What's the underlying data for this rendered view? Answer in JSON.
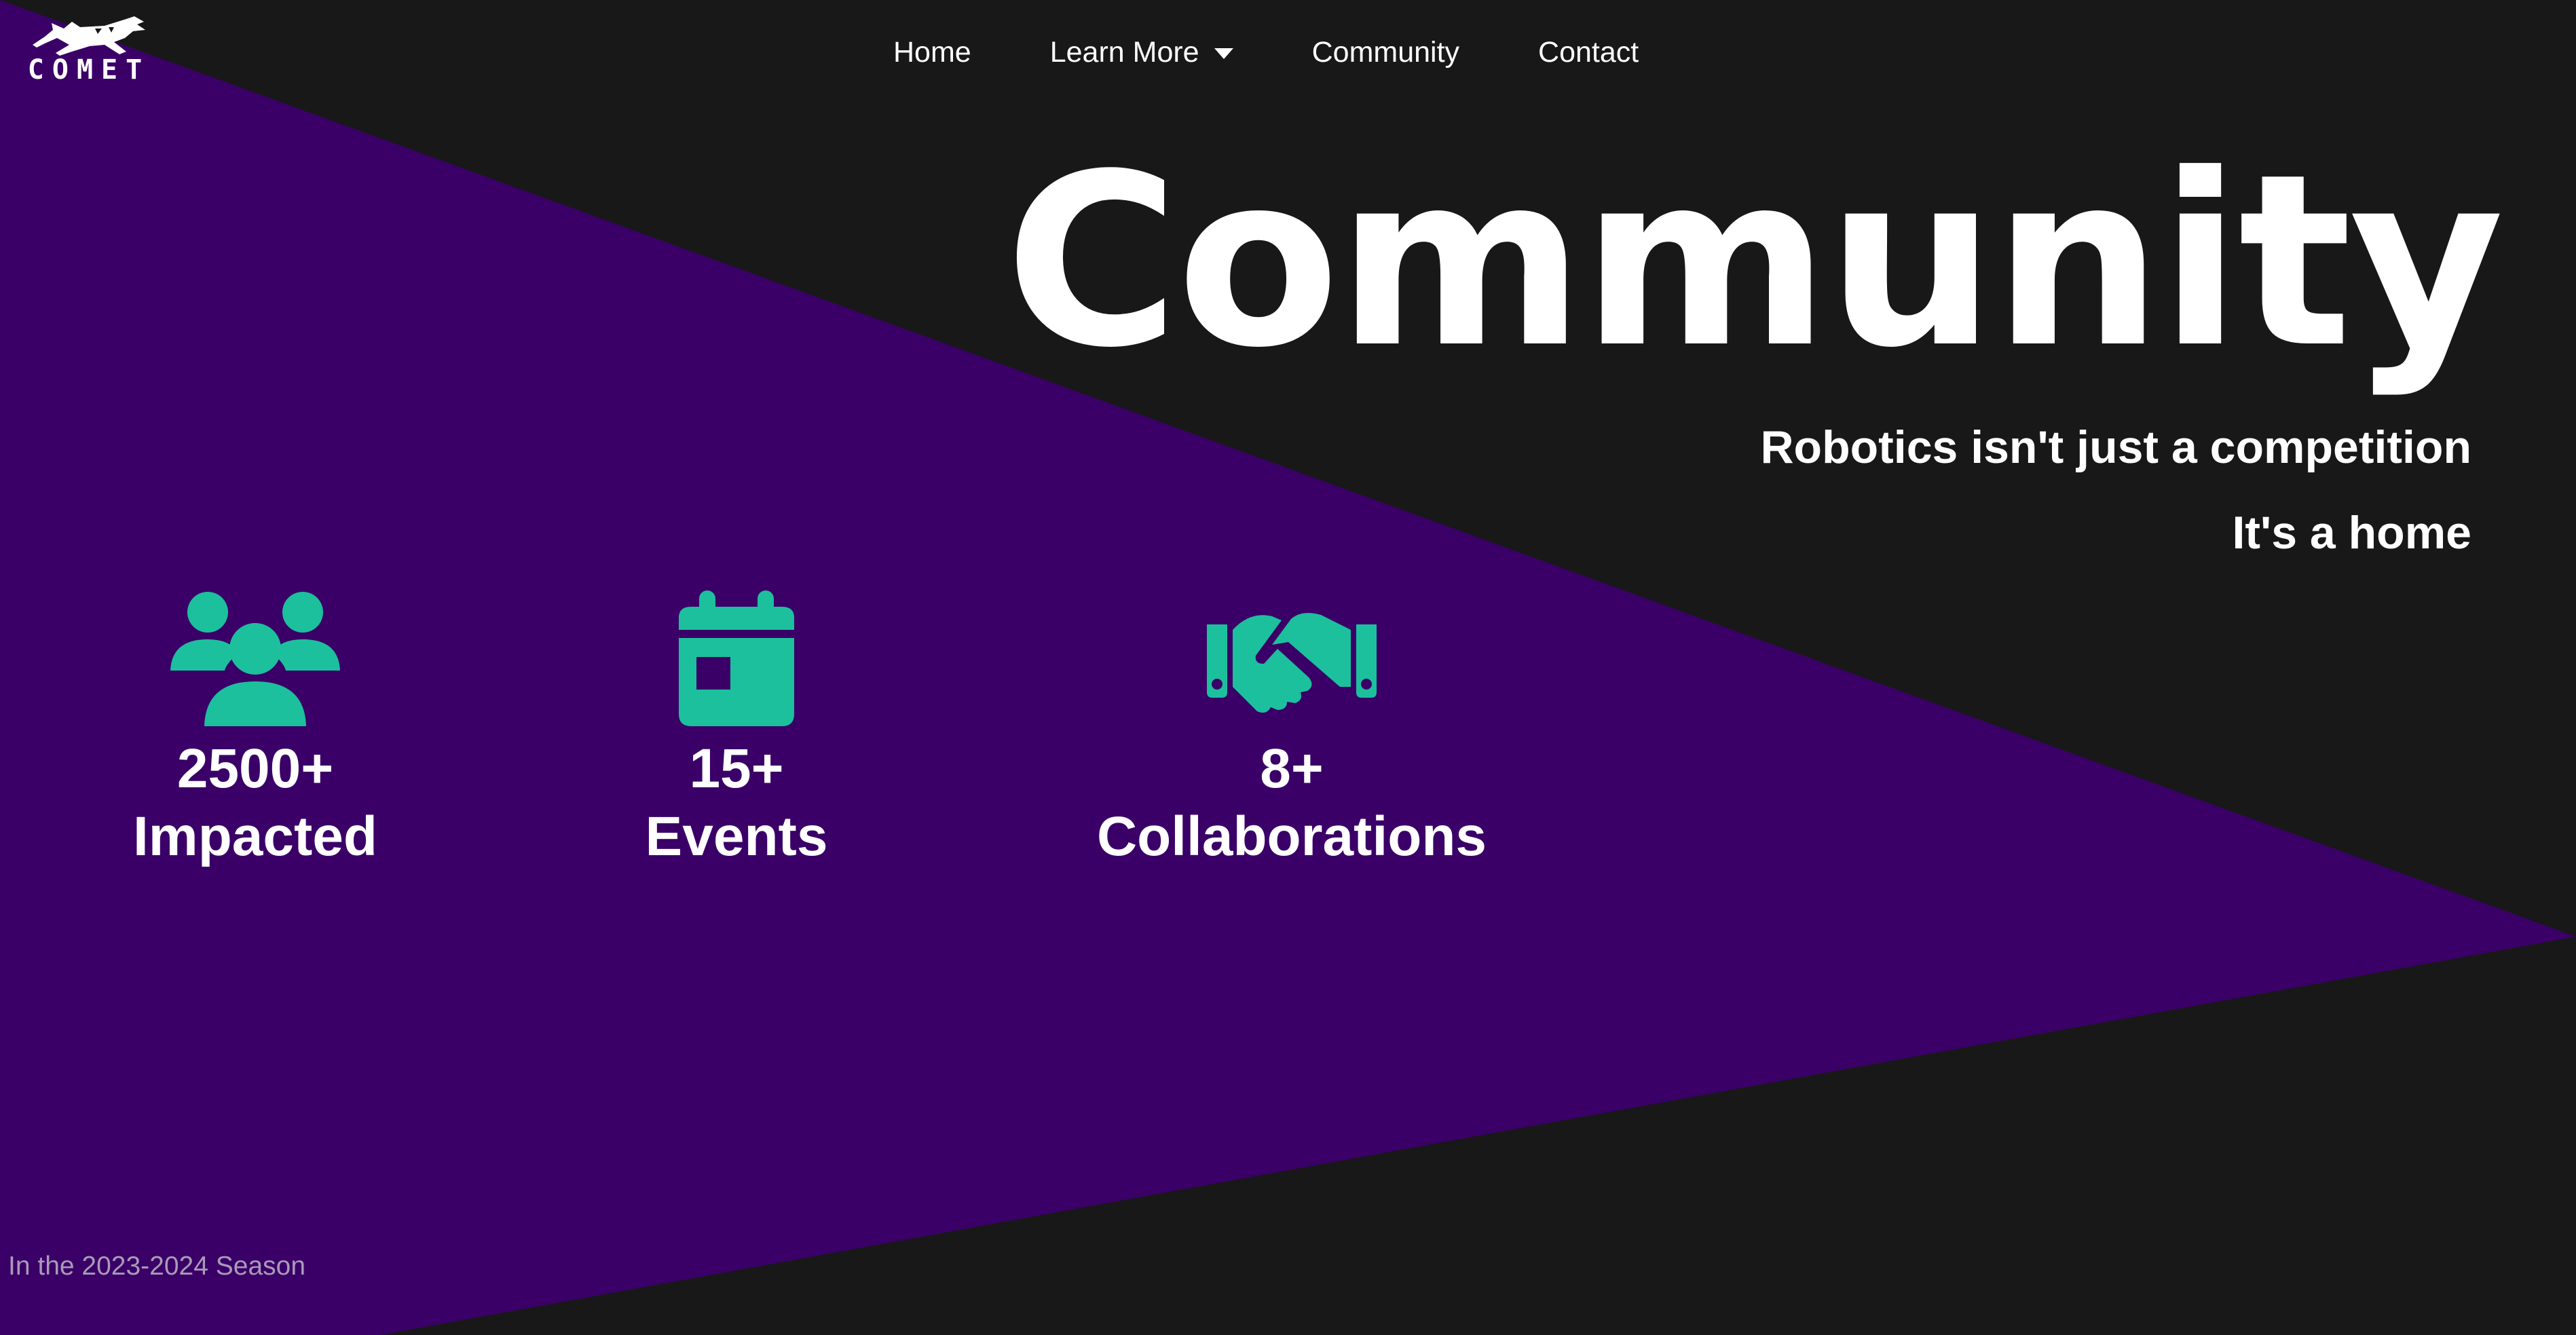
{
  "brand": {
    "logo_text": "COMET"
  },
  "nav": {
    "items": [
      {
        "label": "Home"
      },
      {
        "label": "Learn More"
      },
      {
        "label": "Community"
      },
      {
        "label": "Contact"
      }
    ]
  },
  "hero": {
    "title": "Community",
    "subtitle_line1": "Robotics isn't just a competition",
    "subtitle_line2": "It's a home"
  },
  "stats": [
    {
      "icon": "users-icon",
      "value": "2500+",
      "label": "Impacted"
    },
    {
      "icon": "calendar-icon",
      "value": "15+",
      "label": "Events"
    },
    {
      "icon": "handshake-icon",
      "value": "8+",
      "label": "Collaborations"
    }
  ],
  "footnote": "In the 2023-2024 Season",
  "colors": {
    "background": "#181818",
    "accent_purple": "#3a0068",
    "icon_teal": "#1cc09d",
    "text": "#ffffff",
    "footnote_text": "#a89bb6"
  }
}
